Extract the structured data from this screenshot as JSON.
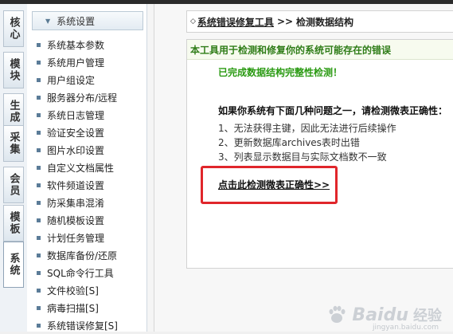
{
  "vertical_tabs": [
    {
      "label": "核心",
      "active": false
    },
    {
      "label": "模块",
      "active": false
    },
    {
      "label": "生成",
      "active": false
    },
    {
      "label": "采集",
      "active": false
    },
    {
      "label": "会员",
      "active": false
    },
    {
      "label": "模板",
      "active": false
    },
    {
      "label": "系统",
      "active": true
    }
  ],
  "sidebar": {
    "header": "系统设置",
    "items": [
      "系统基本参数",
      "系统用户管理",
      "用户组设定",
      "服务器分布/远程",
      "系统日志管理",
      "验证安全设置",
      "图片水印设置",
      "自定义文档属性",
      "软件频道设置",
      "防采集串混淆",
      "随机模板设置",
      "计划任务管理",
      "数据库备份/还原",
      "SQL命令行工具",
      "文件校验[S]",
      "病毒扫描[S]",
      "系统错误修复[S]"
    ]
  },
  "breadcrumb": {
    "diamond": "◇",
    "tool_link": "系统错误修复工具",
    "separator": ">>",
    "current": "检测数据结构"
  },
  "panel": {
    "header": "本工具用于检测和修复你的系统可能存在的错误",
    "success_message": "已完成数据结构完整性检测！",
    "question_title": "如果你系统有下面几种问题之一，请检测微表正确性：",
    "issues": [
      "1、无法获得主键，因此无法进行后续操作",
      "2、更新数据库archives表时出错",
      "3、列表显示数据目与实际文档数不一致"
    ],
    "action_link": "点击此检测微表正确性>>"
  },
  "watermark": {
    "brand": "Baidu",
    "product": "经验",
    "url": "jingyan.baidu.com"
  },
  "colors": {
    "success_green": "#2a9a12",
    "header_green": "#2f7d18",
    "highlight_red": "#e0262b"
  }
}
